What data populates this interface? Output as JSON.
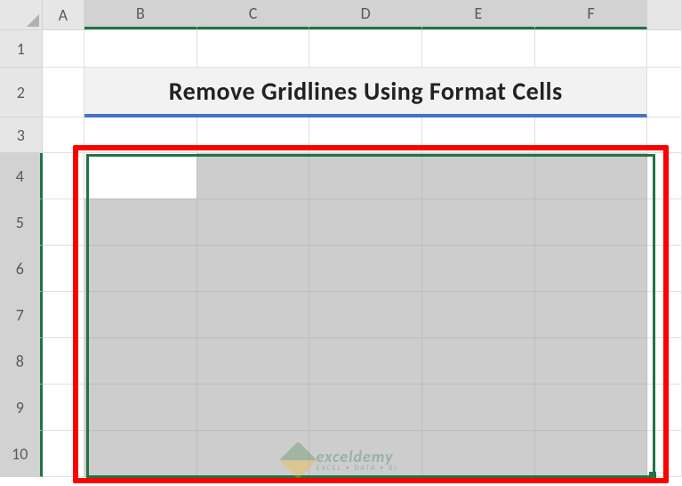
{
  "columns": {
    "A": "A",
    "B": "B",
    "C": "C",
    "D": "D",
    "E": "E",
    "F": "F"
  },
  "rows": {
    "r1": "1",
    "r2": "2",
    "r3": "3",
    "r4": "4",
    "r5": "5",
    "r6": "6",
    "r7": "7",
    "r8": "8",
    "r9": "9",
    "r10": "10"
  },
  "title": "Remove Gridlines Using Format Cells",
  "selection": {
    "range": "B4:F10",
    "active": "B4"
  },
  "watermark": {
    "brand": "exceldemy",
    "tagline": "EXCEL • DATA • BI"
  },
  "colors": {
    "excel_green": "#217346",
    "accent_blue": "#4472c4",
    "annotation_red": "#ff0000"
  }
}
